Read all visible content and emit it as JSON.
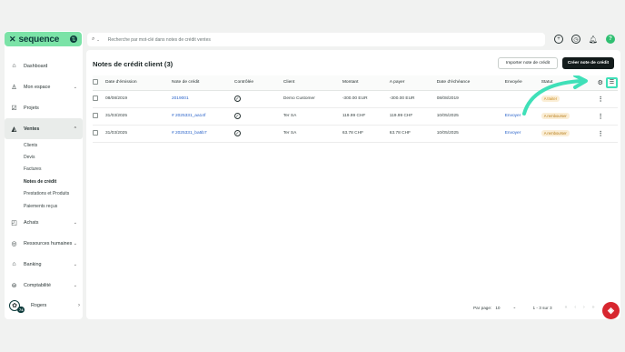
{
  "app": {
    "name": "sequence"
  },
  "sidebar": {
    "items": [
      {
        "label": "Dashboard",
        "icon": "home-icon",
        "expandable": false
      },
      {
        "label": "Mon espace",
        "icon": "user-icon",
        "expandable": true
      },
      {
        "label": "Projets",
        "icon": "check-square-icon",
        "expandable": false
      },
      {
        "label": "Ventes",
        "icon": "money-bag-icon",
        "expandable": true,
        "active": true
      },
      {
        "label": "Achats",
        "icon": "shopping-bag-icon",
        "expandable": true
      },
      {
        "label": "Ressources humaines",
        "icon": "hr-icon",
        "expandable": true
      },
      {
        "label": "Banking",
        "icon": "bank-icon",
        "expandable": true
      },
      {
        "label": "Comptabilité",
        "icon": "accounting-icon",
        "expandable": true
      }
    ],
    "sub_items": [
      "Clients",
      "Devis",
      "Factures",
      "Notes de crédit",
      "Prestations et Produits",
      "Paiements reçus"
    ],
    "active_sub": "Notes de crédit",
    "user": {
      "name": "Rogers",
      "badge": "74"
    }
  },
  "search": {
    "placeholder": "Recherche par mot-clé dans notes de crédit ventes"
  },
  "header": {
    "title": "Notes de crédit client (3)",
    "import_label": "Importer note de crédit",
    "create_label": "Créer note de crédit"
  },
  "table": {
    "columns": [
      "Date d'émission",
      "Note de crédit",
      "Contrôlée",
      "Client",
      "Montant",
      "A payer",
      "Date d'échéance",
      "Envoyée",
      "Statut"
    ],
    "rows": [
      {
        "date": "08/08/2019",
        "note": "2019001",
        "client": "Demo Customer",
        "amount": "-300.00 EUR",
        "to_pay": "-300.00 EUR",
        "due": "08/08/2019",
        "sent": "",
        "status": "A traiter"
      },
      {
        "date": "31/03/2025",
        "note": "# 2025331_aa14f",
        "client": "Ter SA",
        "amount": "119.99 CHF",
        "to_pay": "119.99 CHF",
        "due": "10/05/2025",
        "sent": "Envoyer",
        "status": "A rembourser"
      },
      {
        "date": "31/03/2025",
        "note": "# 2025331_ba5b7",
        "client": "Ter SA",
        "amount": "63.78 CHF",
        "to_pay": "63.78 CHF",
        "due": "10/05/2025",
        "sent": "Envoyer",
        "status": "A rembourser"
      }
    ]
  },
  "footer": {
    "per_page_label": "Par page:",
    "per_page_value": "10",
    "range": "1 - 3 sur 3"
  },
  "colors": {
    "accent": "#7be3a7",
    "highlight": "#3fe0b8",
    "link": "#2a63c9",
    "dark": "#131b1b"
  }
}
